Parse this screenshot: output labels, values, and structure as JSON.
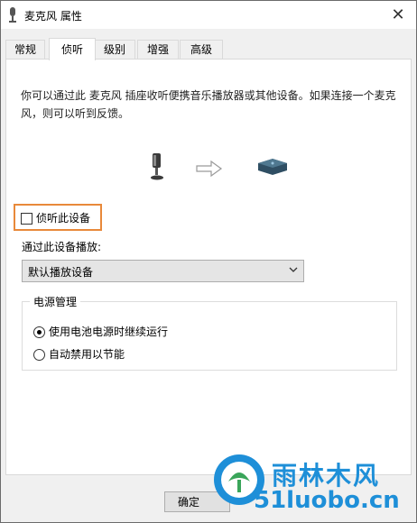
{
  "window": {
    "title": "麦克风 属性",
    "close_symbol": "✕",
    "title_icon": "microphone-icon"
  },
  "tabs": [
    {
      "label": "常规",
      "active": false
    },
    {
      "label": "侦听",
      "active": true
    },
    {
      "label": "级别",
      "active": false
    },
    {
      "label": "增强",
      "active": false
    },
    {
      "label": "高级",
      "active": false
    }
  ],
  "listen": {
    "description": "你可以通过此 麦克风 插座收听便携音乐播放器或其他设备。如果连接一个麦克风，则可以听到反馈。",
    "diagram_icons": [
      "microphone-icon",
      "arrow-right-icon",
      "speaker-device-icon"
    ],
    "checkbox_label": "侦听此设备",
    "checkbox_checked": false,
    "highlight_color": "#e8893a",
    "playback_label": "通过此设备播放:",
    "playback_value": "默认播放设备"
  },
  "power": {
    "group_title": "电源管理",
    "options": [
      {
        "label": "使用电池电源时继续运行",
        "selected": true
      },
      {
        "label": "自动禁用以节能",
        "selected": false
      }
    ]
  },
  "buttons": {
    "ok": "确定"
  },
  "watermark": {
    "brand": "雨林木风",
    "url": "51luobo.cn",
    "color": "#1e8fd8"
  }
}
